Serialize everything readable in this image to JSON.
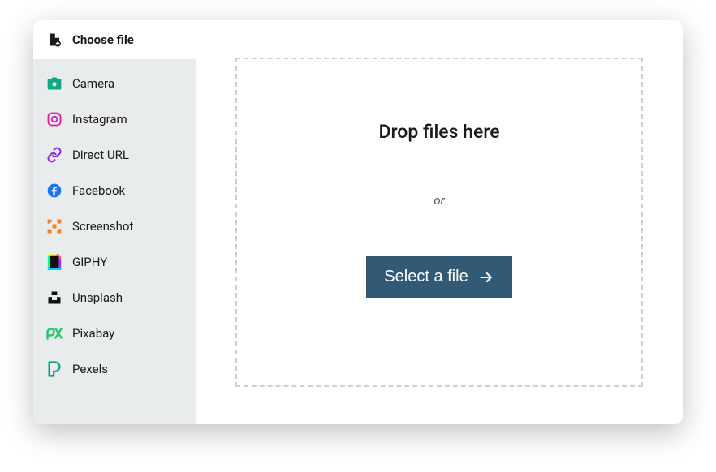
{
  "header": {
    "title": "Choose file"
  },
  "sources": [
    {
      "id": "camera",
      "label": "Camera",
      "icon": "camera-icon"
    },
    {
      "id": "instagram",
      "label": "Instagram",
      "icon": "instagram-icon"
    },
    {
      "id": "direct-url",
      "label": "Direct URL",
      "icon": "link-icon"
    },
    {
      "id": "facebook",
      "label": "Facebook",
      "icon": "facebook-icon"
    },
    {
      "id": "screenshot",
      "label": "Screenshot",
      "icon": "screenshot-icon"
    },
    {
      "id": "giphy",
      "label": "GIPHY",
      "icon": "giphy-icon"
    },
    {
      "id": "unsplash",
      "label": "Unsplash",
      "icon": "unsplash-icon"
    },
    {
      "id": "pixabay",
      "label": "Pixabay",
      "icon": "pixabay-icon"
    },
    {
      "id": "pexels",
      "label": "Pexels",
      "icon": "pexels-icon"
    }
  ],
  "dropzone": {
    "title": "Drop files here",
    "or": "or",
    "button": "Select a file"
  },
  "colors": {
    "primaryBtn": "#335a74",
    "sidebarBg": "#e9ecec",
    "camera": "#0ea884",
    "instagram": "#d6249f",
    "link": "#8a2be2",
    "facebook": "#1877f2",
    "screenshot": "#f58220",
    "pixabay": "#2ec66d",
    "pexels": "#05a081"
  }
}
